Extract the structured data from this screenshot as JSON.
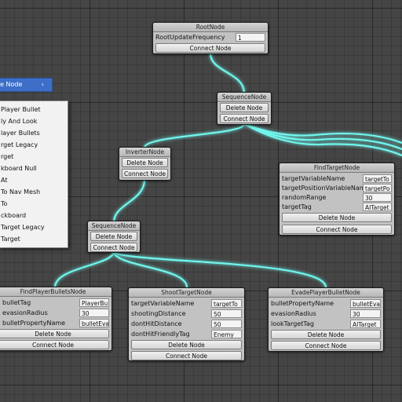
{
  "menu": {
    "header_label": "e Node",
    "header_arrow": "›",
    "items": [
      "Player Bullet",
      "ly And Look",
      "layer Bullets",
      "rget Legacy",
      "rget",
      "kboard Null",
      "At",
      "To Nav Mesh",
      "To",
      "ckboard",
      "Target Legacy",
      "Target"
    ]
  },
  "nodes": {
    "root": {
      "title": "RootNode",
      "fields": [
        {
          "label": "RootUpdateFrequency",
          "value": "1"
        }
      ],
      "connect": "Connect Node"
    },
    "seq1": {
      "title": "SequenceNode",
      "delete": "Delete Node",
      "connect": "Connect Node"
    },
    "inverter": {
      "title": "InverterNode",
      "delete": "Delete Node",
      "connect": "Connect Node"
    },
    "find_target": {
      "title": "FindTargetNode",
      "fields": [
        {
          "label": "targetVariableName",
          "value": "targetTo"
        },
        {
          "label": "targetPositionVariableNam",
          "value": "targetPo"
        },
        {
          "label": "randomRange",
          "value": "30"
        },
        {
          "label": "targetTag",
          "value": "AITarget"
        }
      ],
      "delete": "Delete Node",
      "connect": "Connect Node"
    },
    "seq2": {
      "title": "SequenceNode",
      "delete": "Delete Node",
      "connect": "Connect Node"
    },
    "find_bullets": {
      "title": "FindPlayerBulletsNode",
      "fields": [
        {
          "label": "bulletTag",
          "value": "PlayerBu"
        },
        {
          "label": "evasionRadius",
          "value": "30"
        },
        {
          "label": "bulletPropertyName",
          "value": "bulletEva"
        }
      ],
      "delete": "Delete Node",
      "connect": "Connect Node"
    },
    "shoot_target": {
      "title": "ShootTargetNode",
      "fields": [
        {
          "label": "targetVariableName",
          "value": "targetTo"
        },
        {
          "label": "shootingDistance",
          "value": "50"
        },
        {
          "label": "dontHitDistance",
          "value": "50"
        },
        {
          "label": "dontHitFriendlyTag",
          "value": "Enemy"
        }
      ],
      "delete": "Delete Node",
      "connect": "Connect Node"
    },
    "evade": {
      "title": "EvadePlayerBulletNode",
      "fields": [
        {
          "label": "bulletPropertyName",
          "value": "bulletEva"
        },
        {
          "label": "evasionRadius",
          "value": "30"
        },
        {
          "label": "lookTargetTag",
          "value": "AITarget"
        }
      ],
      "delete": "Delete Node",
      "connect": "Connect Node"
    }
  },
  "colors": {
    "wire": "#6ff5ec",
    "wire_glow": "#27c9c1",
    "canvas": "#454545",
    "node": "#c2c2c2",
    "menu_highlight": "#3d6fc8"
  }
}
